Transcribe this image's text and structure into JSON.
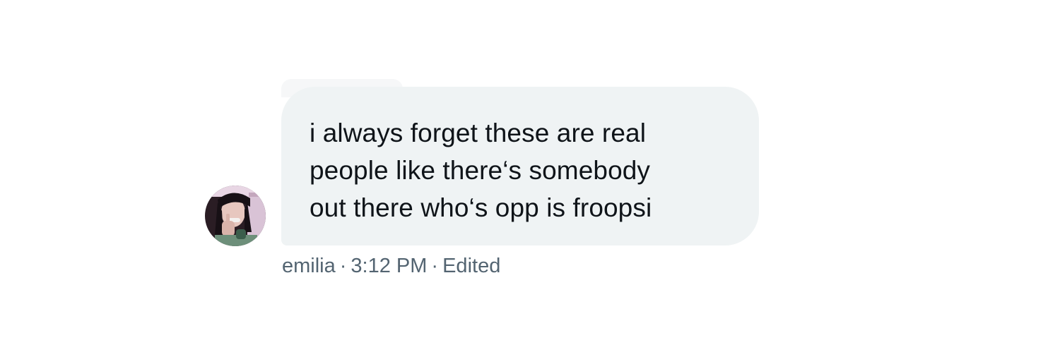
{
  "message": {
    "text": "i always forget these are real\npeople like there‘s somebody\nout there who‘s opp is froopsi",
    "sender": "emilia",
    "time": "3:12 PM",
    "status": "Edited",
    "separator": "·"
  },
  "avatar": {
    "icon": "user-avatar-photo"
  },
  "colors": {
    "bubble_bg": "#eff3f4",
    "text": "#0f1419",
    "meta_text": "#536471"
  }
}
